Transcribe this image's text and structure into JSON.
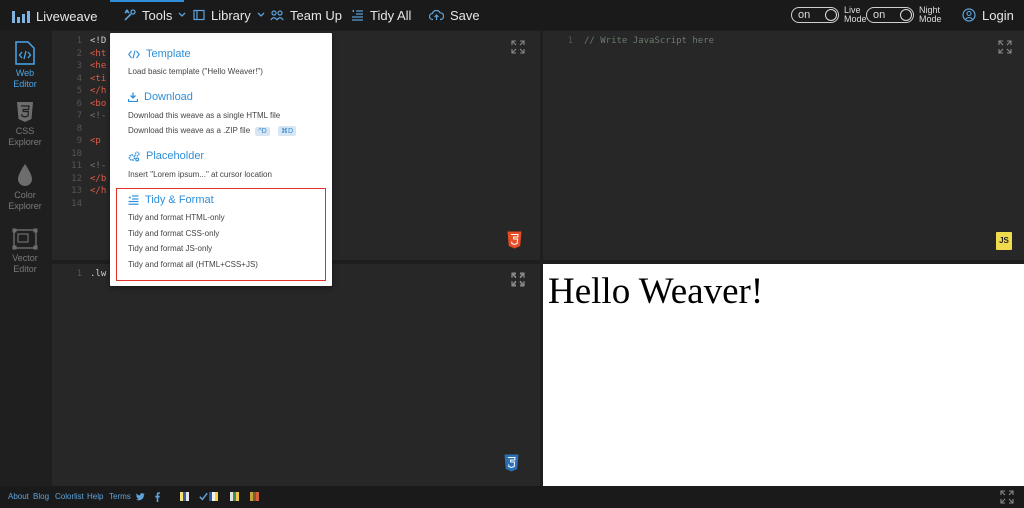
{
  "topbar": {
    "brand": "Liveweave",
    "tools": "Tools",
    "library": "Library",
    "team_up": "Team Up",
    "tidy_all": "Tidy All",
    "save": "Save",
    "live_toggle_state": "on",
    "live_mode_line1": "Live",
    "live_mode_line2": "Mode",
    "night_toggle_state": "on",
    "night_mode_line1": "Night",
    "night_mode_line2": "Mode",
    "login": "Login"
  },
  "sidebar": {
    "items": [
      {
        "line1": "Web",
        "line2": "Editor"
      },
      {
        "line1": "CSS",
        "line2": "Explorer"
      },
      {
        "line1": "Color",
        "line2": "Explorer"
      },
      {
        "line1": "Vector",
        "line2": "Editor"
      }
    ]
  },
  "html_pane": {
    "line_numbers": [
      "1",
      "2",
      "3",
      "4",
      "5",
      "6",
      "7",
      "8",
      "9",
      "10",
      "11",
      "12",
      "13",
      "14"
    ],
    "lines": [
      "<!D",
      "<ht",
      "<he",
      "<ti",
      "</h",
      "<bo",
      "<!-",
      "",
      "<p",
      "",
      "<!-",
      "</b",
      "</h",
      ""
    ],
    "badge_icon": "html5-icon"
  },
  "js_pane": {
    "line_numbers": [
      "1"
    ],
    "lines": [
      "// Write JavaScript here"
    ],
    "badge": "JS"
  },
  "css_pane": {
    "line_numbers": [
      "1"
    ],
    "lines": [
      ".lw"
    ],
    "badge_icon": "css3-icon"
  },
  "preview": {
    "heading": "Hello Weaver!"
  },
  "menu": {
    "template_title": "Template",
    "template_desc": "Load basic template (\"Hello Weaver!\")",
    "download_title": "Download",
    "download_desc1": "Download this weave as a single HTML file",
    "download_desc2": "Download this weave as a .ZIP file",
    "download_key1": "^D",
    "download_key2": "⌘D",
    "placeholder_title": "Placeholder",
    "placeholder_desc": "Insert \"Lorem ipsum...\" at cursor location",
    "tidy_title": "Tidy & Format",
    "tidy_html": "Tidy and format HTML-only",
    "tidy_css": "Tidy and format CSS-only",
    "tidy_js": "Tidy and format JS-only",
    "tidy_all": "Tidy and format all (HTML+CSS+JS)"
  },
  "footer": {
    "about": "About",
    "blog": "Blog",
    "colorlist": "Colorlist",
    "help": "Help",
    "terms": "Terms"
  },
  "colors": {
    "accent": "#2f8fd8",
    "highlight_border": "#e0302a",
    "html_badge": "#e44d26",
    "css_badge": "#2b6fb6",
    "js_badge": "#f0db4f"
  }
}
